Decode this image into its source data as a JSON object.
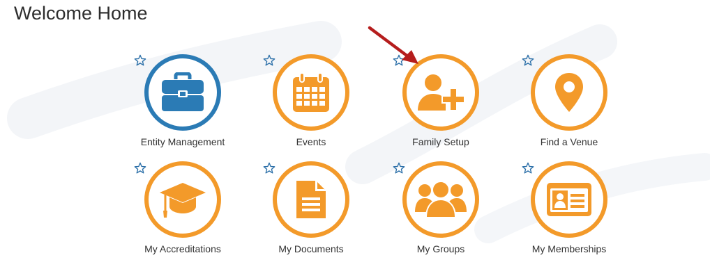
{
  "page": {
    "title": "Welcome Home"
  },
  "colors": {
    "orange": "#f39a2a",
    "blue": "#2b7bb5",
    "star": "#2b6fa8",
    "arrow": "#b51d1d"
  },
  "tiles": [
    {
      "label": "Entity Management",
      "icon": "briefcase-icon",
      "color": "blue"
    },
    {
      "label": "Events",
      "icon": "calendar-icon",
      "color": "orange"
    },
    {
      "label": "Family Setup",
      "icon": "add-user-icon",
      "color": "orange"
    },
    {
      "label": "Find a Venue",
      "icon": "map-pin-icon",
      "color": "orange"
    },
    {
      "label": "My Accreditations",
      "icon": "graduation-cap-icon",
      "color": "orange"
    },
    {
      "label": "My Documents",
      "icon": "document-icon",
      "color": "orange"
    },
    {
      "label": "My Groups",
      "icon": "group-icon",
      "color": "orange"
    },
    {
      "label": "My Memberships",
      "icon": "id-card-icon",
      "color": "orange"
    }
  ],
  "favorite_icon": "star-outline-icon",
  "annotation": {
    "icon": "red-arrow-icon",
    "points_to": "Family Setup"
  }
}
